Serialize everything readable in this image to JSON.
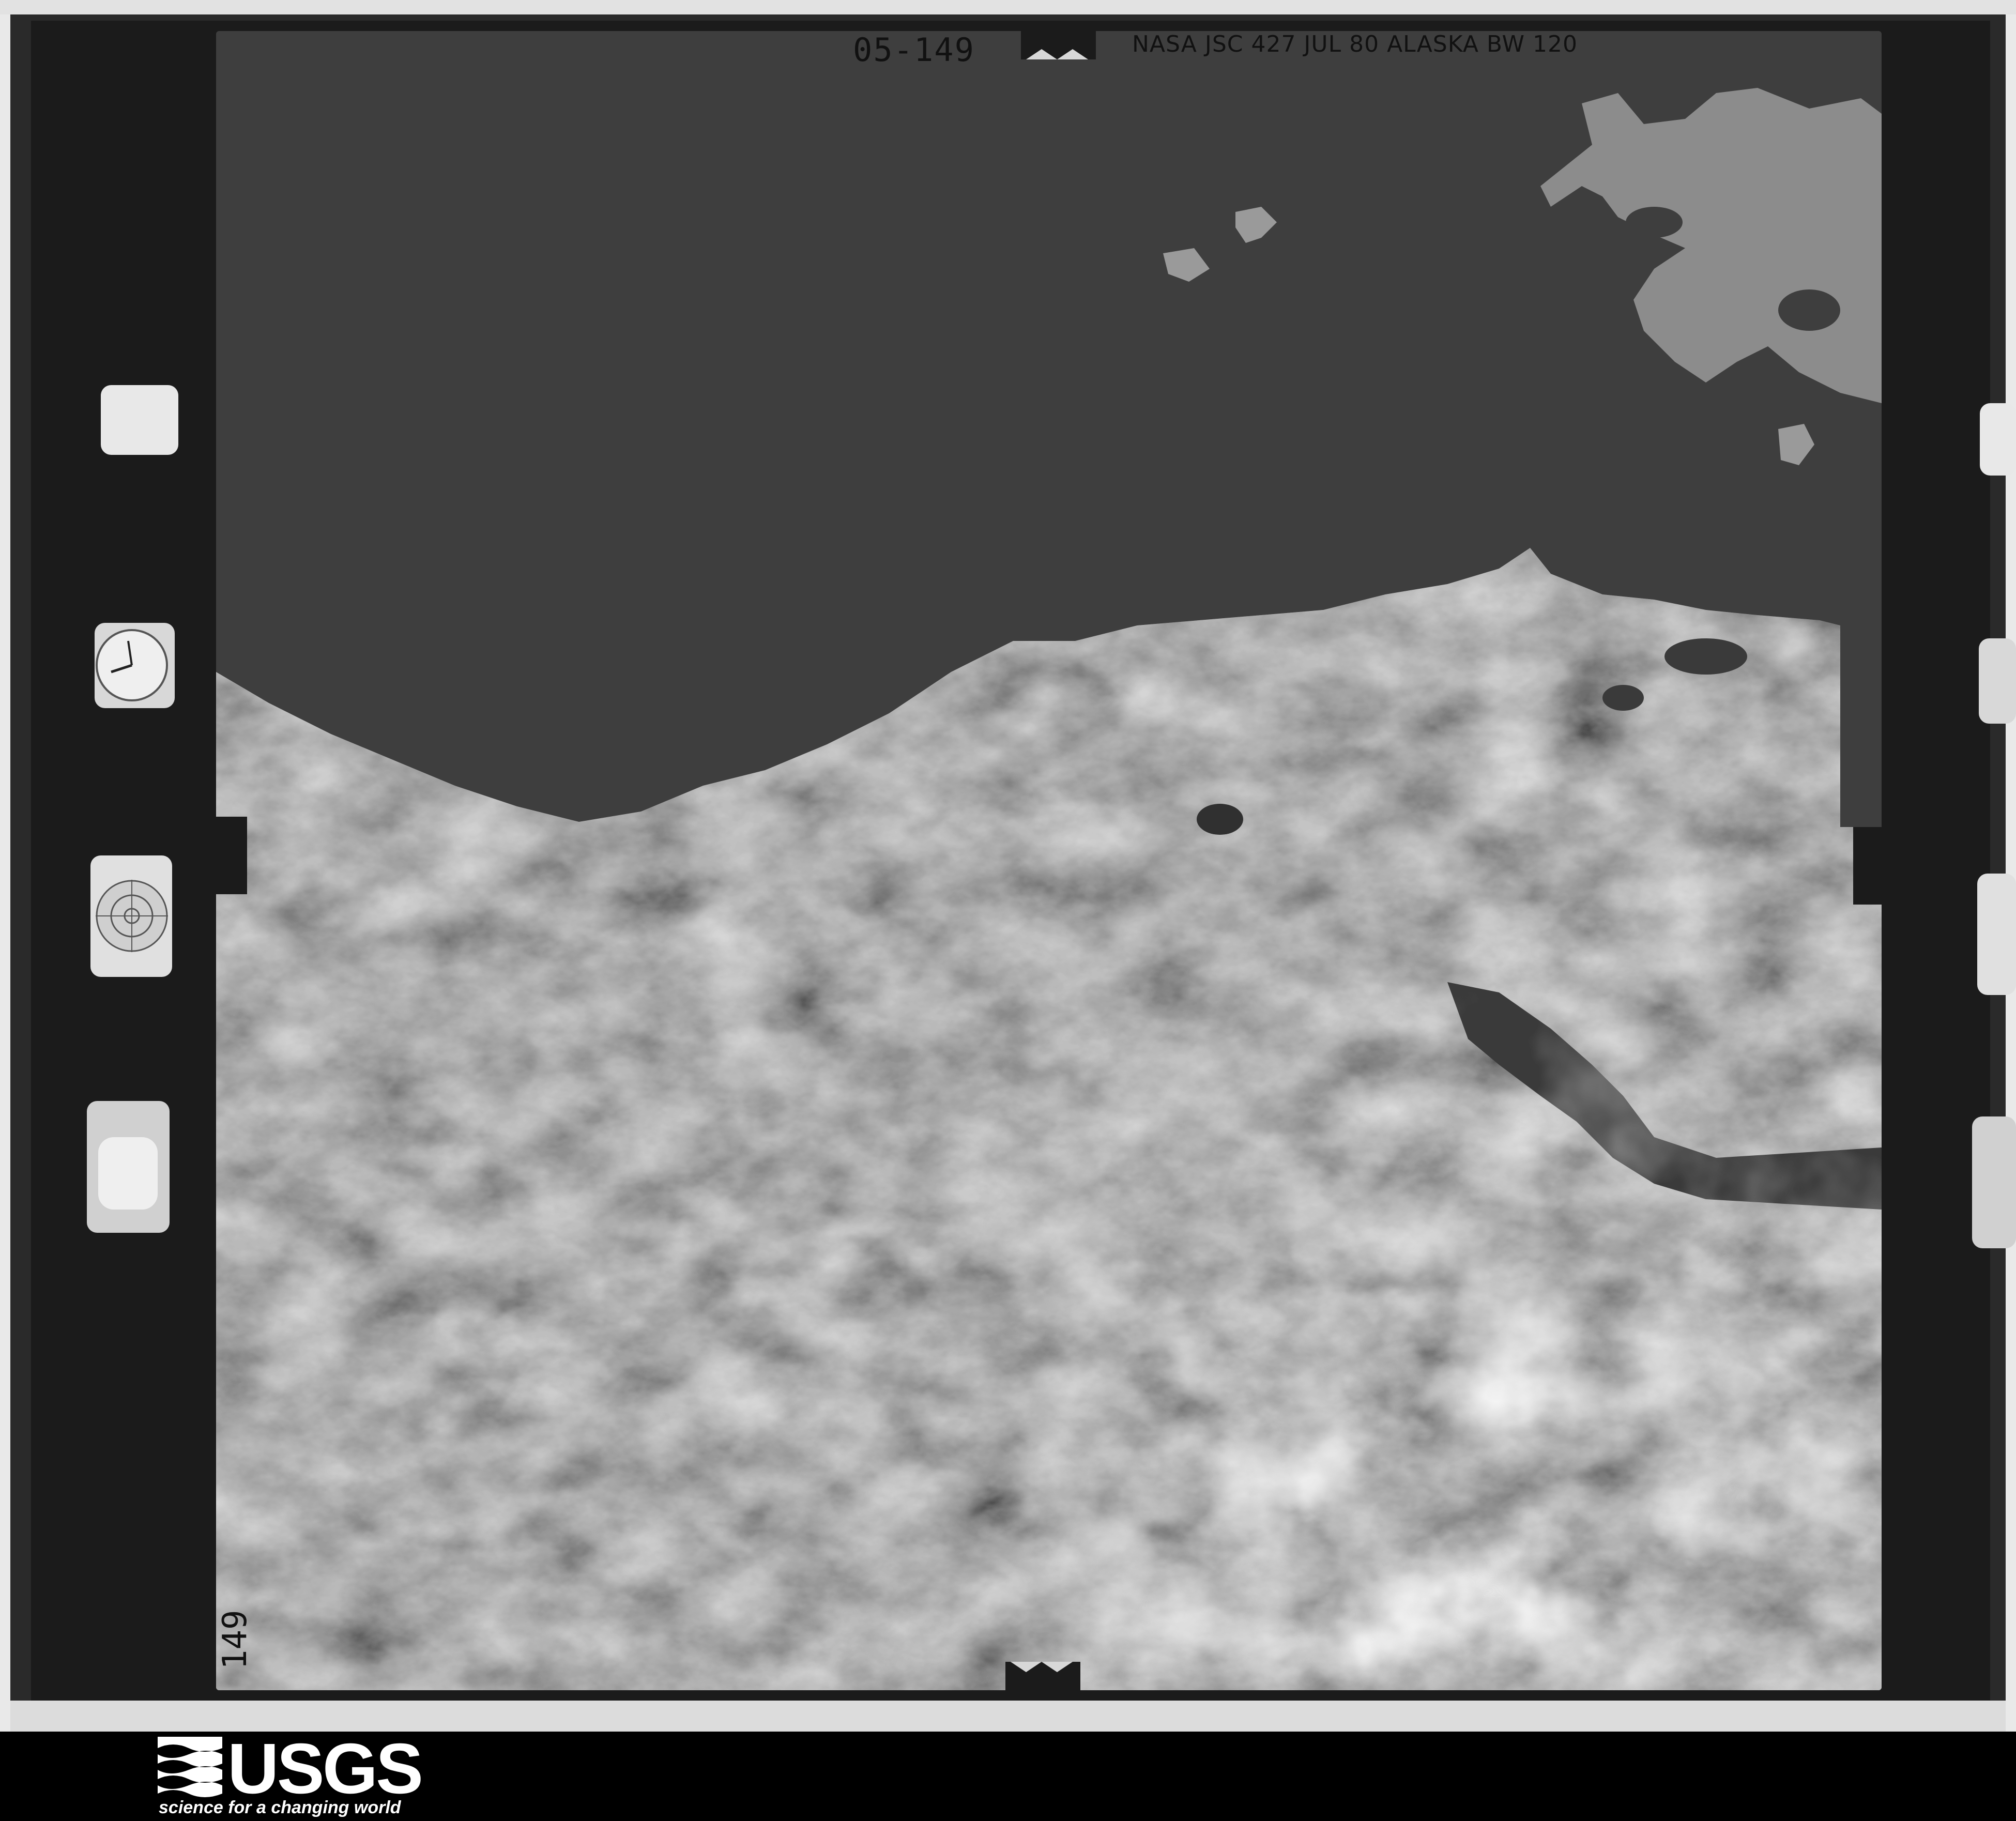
{
  "film": {
    "frame_number": "05-149",
    "caption": "NASA JSC 427 JUL 80 ALASKA BW 120",
    "side_frame_label": "149"
  },
  "logo": {
    "wordmark": "USGS",
    "tagline": "science for a changing world"
  }
}
